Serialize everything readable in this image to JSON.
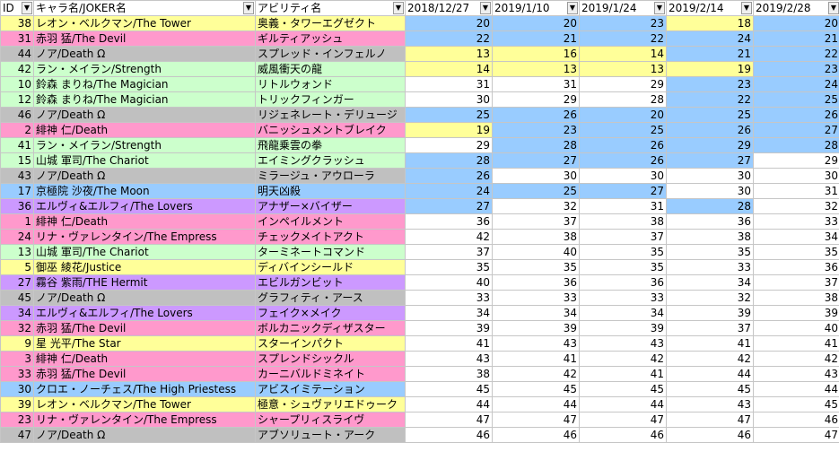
{
  "headers": [
    "ID",
    "キャラ名/JOKER名",
    "アビリティ名",
    "2018/12/27",
    "2019/1/10",
    "2019/1/24",
    "2019/2/14",
    "2019/2/28"
  ],
  "colors": {
    "yellow": "#ffff99",
    "pink": "#ff99cc",
    "gray": "#c0c0c0",
    "green": "#ccffcc",
    "lightblue": "#99ccff",
    "purple": "#cc99ff",
    "white": "#ffffff"
  },
  "rows": [
    {
      "id": 38,
      "name": "レオン・ベルクマン/The Tower",
      "ability": "奥義・タワーエグゼクト",
      "values": [
        20,
        20,
        23,
        18,
        20
      ],
      "color": "yellow",
      "cells": [
        "lightblue",
        "lightblue",
        "lightblue",
        "yellow",
        "lightblue"
      ]
    },
    {
      "id": 31,
      "name": "赤羽 猛/The Devil",
      "ability": "ギルティアッシュ",
      "values": [
        22,
        21,
        22,
        24,
        21
      ],
      "color": "pink",
      "cells": [
        "lightblue",
        "lightblue",
        "lightblue",
        "lightblue",
        "lightblue"
      ]
    },
    {
      "id": 44,
      "name": "ノア/Death Ω",
      "ability": "スプレッド・インフェルノ",
      "values": [
        13,
        16,
        14,
        21,
        22
      ],
      "color": "gray",
      "cells": [
        "yellow",
        "yellow",
        "yellow",
        "lightblue",
        "lightblue"
      ]
    },
    {
      "id": 42,
      "name": "ラン・メイラン/Strength",
      "ability": "威風衝天の龍",
      "values": [
        14,
        13,
        13,
        19,
        23
      ],
      "color": "green",
      "cells": [
        "yellow",
        "yellow",
        "yellow",
        "yellow",
        "lightblue"
      ]
    },
    {
      "id": 10,
      "name": "鈴森 まりね/The Magician",
      "ability": "リトルウォンド",
      "values": [
        31,
        31,
        29,
        23,
        24
      ],
      "color": "green",
      "cells": [
        "white",
        "white",
        "white",
        "lightblue",
        "lightblue"
      ]
    },
    {
      "id": 12,
      "name": "鈴森 まりね/The Magician",
      "ability": "トリックフィンガー",
      "values": [
        30,
        29,
        28,
        22,
        25
      ],
      "color": "green",
      "cells": [
        "white",
        "white",
        "white",
        "lightblue",
        "lightblue"
      ]
    },
    {
      "id": 46,
      "name": "ノア/Death Ω",
      "ability": "リジェネレート・デリュージ",
      "values": [
        25,
        26,
        20,
        25,
        26
      ],
      "color": "gray",
      "cells": [
        "lightblue",
        "lightblue",
        "lightblue",
        "lightblue",
        "lightblue"
      ]
    },
    {
      "id": 2,
      "name": "緋神 仁/Death",
      "ability": "バニッシュメントブレイク",
      "values": [
        19,
        23,
        25,
        26,
        27
      ],
      "color": "pink",
      "cells": [
        "yellow",
        "lightblue",
        "lightblue",
        "lightblue",
        "lightblue"
      ]
    },
    {
      "id": 41,
      "name": "ラン・メイラン/Strength",
      "ability": "飛龍乗雲の拳",
      "values": [
        29,
        28,
        26,
        29,
        28
      ],
      "color": "green",
      "cells": [
        "white",
        "lightblue",
        "lightblue",
        "lightblue",
        "lightblue"
      ]
    },
    {
      "id": 15,
      "name": "山城 軍司/The Chariot",
      "ability": "エイミングクラッシュ",
      "values": [
        28,
        27,
        26,
        27,
        29
      ],
      "color": "green",
      "cells": [
        "lightblue",
        "lightblue",
        "lightblue",
        "lightblue",
        "white"
      ]
    },
    {
      "id": 43,
      "name": "ノア/Death Ω",
      "ability": "ミラージュ・アウローラ",
      "values": [
        26,
        30,
        30,
        30,
        30
      ],
      "color": "gray",
      "cells": [
        "lightblue",
        "white",
        "white",
        "white",
        "white"
      ]
    },
    {
      "id": 17,
      "name": "京極院 沙夜/The Moon",
      "ability": "明天凶殺",
      "values": [
        24,
        25,
        27,
        30,
        31
      ],
      "color": "lightblue",
      "cells": [
        "lightblue",
        "lightblue",
        "lightblue",
        "white",
        "white"
      ]
    },
    {
      "id": 36,
      "name": "エルヴィ&エルフィ/The Lovers",
      "ability": "アナザー×バイザー",
      "values": [
        27,
        32,
        31,
        28,
        32
      ],
      "color": "purple",
      "cells": [
        "lightblue",
        "white",
        "white",
        "lightblue",
        "white"
      ]
    },
    {
      "id": 1,
      "name": "緋神 仁/Death",
      "ability": "インペイルメント",
      "values": [
        36,
        37,
        38,
        36,
        33
      ],
      "color": "pink",
      "cells": [
        "white",
        "white",
        "white",
        "white",
        "white"
      ]
    },
    {
      "id": 24,
      "name": "リナ・ヴァレンタイン/The Empress",
      "ability": "チェックメイトアクト",
      "values": [
        42,
        38,
        37,
        38,
        34
      ],
      "color": "pink",
      "cells": [
        "white",
        "white",
        "white",
        "white",
        "white"
      ]
    },
    {
      "id": 13,
      "name": "山城 軍司/The Chariot",
      "ability": "ターミネートコマンド",
      "values": [
        37,
        40,
        35,
        35,
        35
      ],
      "color": "green",
      "cells": [
        "white",
        "white",
        "white",
        "white",
        "white"
      ]
    },
    {
      "id": 5,
      "name": "御巫 綾花/Justice",
      "ability": "ディバインシールド",
      "values": [
        35,
        35,
        35,
        33,
        36
      ],
      "color": "yellow",
      "cells": [
        "white",
        "white",
        "white",
        "white",
        "white"
      ]
    },
    {
      "id": 27,
      "name": "霧谷 紫雨/THE Hermit",
      "ability": "エビルガンビット",
      "values": [
        40,
        36,
        36,
        34,
        37
      ],
      "color": "purple",
      "cells": [
        "white",
        "white",
        "white",
        "white",
        "white"
      ]
    },
    {
      "id": 45,
      "name": "ノア/Death Ω",
      "ability": "グラフィティ・アース",
      "values": [
        33,
        33,
        33,
        32,
        38
      ],
      "color": "gray",
      "cells": [
        "white",
        "white",
        "white",
        "white",
        "white"
      ]
    },
    {
      "id": 34,
      "name": "エルヴィ&エルフィ/The Lovers",
      "ability": "フェイク×メイク",
      "values": [
        34,
        34,
        34,
        39,
        39
      ],
      "color": "purple",
      "cells": [
        "white",
        "white",
        "white",
        "white",
        "white"
      ]
    },
    {
      "id": 32,
      "name": "赤羽 猛/The Devil",
      "ability": "ボルカニックディザスター",
      "values": [
        39,
        39,
        39,
        37,
        40
      ],
      "color": "pink",
      "cells": [
        "white",
        "white",
        "white",
        "white",
        "white"
      ]
    },
    {
      "id": 9,
      "name": "星 光平/The Star",
      "ability": "スターインパクト",
      "values": [
        41,
        43,
        43,
        41,
        41
      ],
      "color": "yellow",
      "cells": [
        "white",
        "white",
        "white",
        "white",
        "white"
      ]
    },
    {
      "id": 3,
      "name": "緋神 仁/Death",
      "ability": "スプレンドシックル",
      "values": [
        43,
        41,
        42,
        42,
        42
      ],
      "color": "pink",
      "cells": [
        "white",
        "white",
        "white",
        "white",
        "white"
      ]
    },
    {
      "id": 33,
      "name": "赤羽 猛/The Devil",
      "ability": "カーニバルドミネイト",
      "values": [
        38,
        42,
        41,
        44,
        43
      ],
      "color": "pink",
      "cells": [
        "white",
        "white",
        "white",
        "white",
        "white"
      ]
    },
    {
      "id": 30,
      "name": "クロエ・ノーチェス/The High Priestess",
      "ability": "アビスイミテーション",
      "values": [
        45,
        45,
        45,
        45,
        44
      ],
      "color": "lightblue",
      "cells": [
        "white",
        "white",
        "white",
        "white",
        "white"
      ]
    },
    {
      "id": 39,
      "name": "レオン・ベルクマン/The Tower",
      "ability": "極意・シュヴァリエドゥーク",
      "values": [
        44,
        44,
        44,
        43,
        45
      ],
      "color": "yellow",
      "cells": [
        "white",
        "white",
        "white",
        "white",
        "white"
      ]
    },
    {
      "id": 23,
      "name": "リナ・ヴァレンタイン/The Empress",
      "ability": "シャープリィスライヴ",
      "values": [
        47,
        47,
        47,
        47,
        46
      ],
      "color": "pink",
      "cells": [
        "white",
        "white",
        "white",
        "white",
        "white"
      ]
    },
    {
      "id": 47,
      "name": "ノア/Death Ω",
      "ability": "アブソリュート・アーク",
      "values": [
        46,
        46,
        46,
        46,
        47
      ],
      "color": "gray",
      "cells": [
        "white",
        "white",
        "white",
        "white",
        "white"
      ]
    }
  ]
}
